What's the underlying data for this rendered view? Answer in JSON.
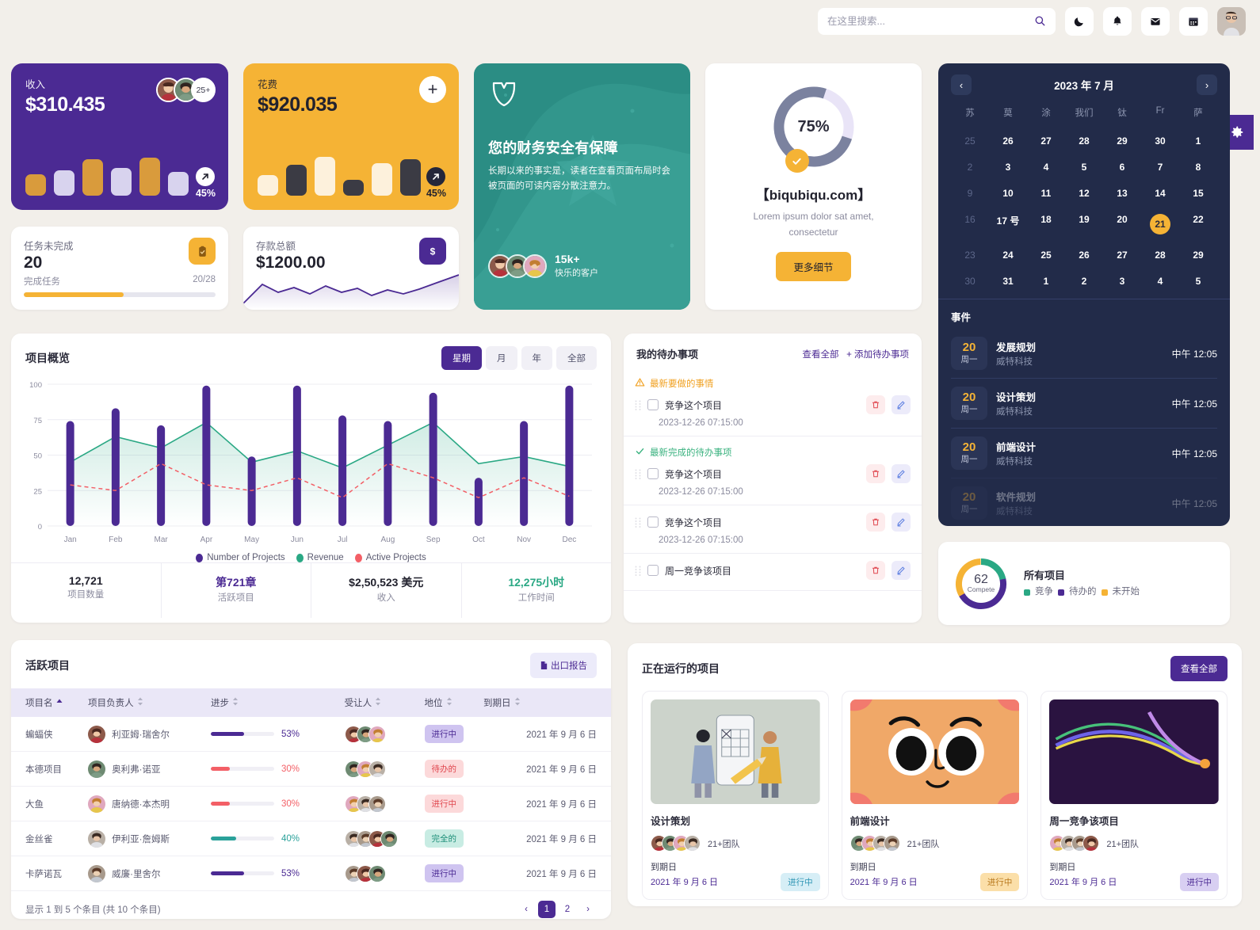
{
  "topbar": {
    "search_placeholder": "在这里搜索...",
    "search_value": "",
    "icons": [
      "moon-icon",
      "bell-icon",
      "mail-icon",
      "calendar-icon"
    ],
    "avatar": "user-avatar"
  },
  "settings_tab": {
    "icon": "gear-icon"
  },
  "kpi": {
    "revenue": {
      "label": "收入",
      "value": "$310.435",
      "extra_count": "25+",
      "percent": "45%",
      "arrow": "arrow-up-right-icon",
      "bars": [
        52,
        62,
        88,
        68,
        92,
        58
      ]
    },
    "expense": {
      "label": "花费",
      "value": "$920.035",
      "percent": "45%",
      "arrow": "arrow-up-right-icon",
      "add_icon": "plus-icon",
      "bars": [
        50,
        75,
        95,
        38,
        78,
        88
      ]
    },
    "tasks": {
      "label": "任务未完成",
      "value": "20",
      "sub_label": "完成任务",
      "ratio": "20/28",
      "progress_percent": 52,
      "icon": "clipboard-check-icon"
    },
    "deposit": {
      "label": "存款总额",
      "value": "$1200.00",
      "icon": "dollar-icon"
    }
  },
  "promo": {
    "title": "您的财务安全有保障",
    "body": "长期以来的事实是，读者在查看页面布局时会被页面的可读内容分散注意力。",
    "logo": "shield-leaf-icon",
    "customers_count": "15k+",
    "customers_label": "快乐的客户"
  },
  "progress_card": {
    "percent": "75%",
    "percent_value": 75,
    "site": "【biqubiqu.com】",
    "lorem": "Lorem ipsum dolor sat amet, consectetur",
    "button": "更多细节",
    "check_icon": "check-icon"
  },
  "calendar": {
    "title": "2023 年 7 月",
    "prev_icon": "chevron-left-icon",
    "next_icon": "chevron-right-icon",
    "dow": [
      "苏",
      "莫",
      "涂",
      "我们",
      "钛",
      "Fr",
      "萨"
    ],
    "weeks": [
      [
        {
          "d": "25",
          "mut": true
        },
        {
          "d": "26"
        },
        {
          "d": "27"
        },
        {
          "d": "28"
        },
        {
          "d": "29"
        },
        {
          "d": "30"
        },
        {
          "d": "1"
        }
      ],
      [
        {
          "d": "2",
          "mut": true
        },
        {
          "d": "3"
        },
        {
          "d": "4"
        },
        {
          "d": "5"
        },
        {
          "d": "6"
        },
        {
          "d": "7"
        },
        {
          "d": "8"
        }
      ],
      [
        {
          "d": "9",
          "mut": true
        },
        {
          "d": "10"
        },
        {
          "d": "11"
        },
        {
          "d": "12"
        },
        {
          "d": "13"
        },
        {
          "d": "14"
        },
        {
          "d": "15"
        }
      ],
      [
        {
          "d": "16",
          "mut": true
        },
        {
          "d": "17 号"
        },
        {
          "d": "18"
        },
        {
          "d": "19"
        },
        {
          "d": "20"
        },
        {
          "d": "21",
          "sel": true
        },
        {
          "d": "22"
        }
      ],
      [
        {
          "d": "23",
          "mut": true
        },
        {
          "d": "24"
        },
        {
          "d": "25"
        },
        {
          "d": "26"
        },
        {
          "d": "27"
        },
        {
          "d": "28"
        },
        {
          "d": "29"
        }
      ],
      [
        {
          "d": "30",
          "mut": true
        },
        {
          "d": "31"
        },
        {
          "d": "1"
        },
        {
          "d": "2"
        },
        {
          "d": "3"
        },
        {
          "d": "4"
        },
        {
          "d": "5"
        }
      ]
    ],
    "events_title": "事件",
    "events": [
      {
        "day": "20",
        "weekday": "周一",
        "name": "发展规划",
        "org": "威特科技",
        "time": "中午 12:05"
      },
      {
        "day": "20",
        "weekday": "周一",
        "name": "设计策划",
        "org": "威特科技",
        "time": "中午 12:05"
      },
      {
        "day": "20",
        "weekday": "周一",
        "name": "前端设计",
        "org": "威特科技",
        "time": "中午 12:05"
      },
      {
        "day": "20",
        "weekday": "周一",
        "name": "软件规划",
        "org": "威特科技",
        "time": "中午 12:05"
      }
    ]
  },
  "overview": {
    "title": "项目概览",
    "range_buttons": [
      "星期",
      "月",
      "年",
      "全部"
    ],
    "active_range": "星期",
    "stats": [
      {
        "value": "12,721",
        "label": "项目数量",
        "color": "#22222e"
      },
      {
        "value": "第721章",
        "label": "活跃项目",
        "color": "#4b2a93"
      },
      {
        "value": "$2,50,523 美元",
        "label": "收入",
        "color": "#22222e"
      },
      {
        "value": "12,275小时",
        "label": "工作时间",
        "color": "#2aa884"
      }
    ]
  },
  "chart_data": {
    "type": "bar",
    "title": "项目概览",
    "xlabel": "",
    "ylabel": "",
    "ylim": [
      0,
      100
    ],
    "yticks": [
      0,
      25,
      50,
      75,
      100
    ],
    "grid": true,
    "legend_position": "bottom",
    "categories": [
      "Jan",
      "Feb",
      "Mar",
      "Apr",
      "May",
      "Jun",
      "Jul",
      "Aug",
      "Sep",
      "Oct",
      "Nov",
      "Dec"
    ],
    "series": [
      {
        "name": "Number of Projects",
        "type": "bar",
        "color": "#4b2a93",
        "values": [
          74,
          83,
          71,
          99,
          49,
          99,
          78,
          74,
          94,
          34,
          74,
          99
        ]
      },
      {
        "name": "Revenue",
        "type": "area",
        "color": "#2aa884",
        "values": [
          45,
          63,
          55,
          73,
          45,
          53,
          41,
          57,
          73,
          44,
          49,
          42
        ]
      },
      {
        "name": "Active Projects",
        "type": "line-dashed",
        "color": "#f35f66",
        "values": [
          29,
          25,
          44,
          29,
          25,
          34,
          20,
          44,
          34,
          20,
          34,
          21
        ]
      }
    ]
  },
  "todo": {
    "title": "我的待办事项",
    "view_all": "查看全部",
    "add": "+ 添加待办事项",
    "groups": [
      {
        "label": "最新要做的事情",
        "icon": "warning-icon",
        "kind": "warn",
        "items": [
          {
            "text": "竞争这个项目",
            "date": "2023-12-26 07:15:00",
            "checked": false
          }
        ]
      },
      {
        "label": "最新完成的待办事项",
        "icon": "check-icon",
        "kind": "done",
        "items": [
          {
            "text": "竞争这个项目",
            "date": "2023-12-26 07:15:00",
            "checked": false
          }
        ]
      },
      {
        "label": "",
        "icon": "",
        "kind": "none",
        "items": [
          {
            "text": "竞争这个项目",
            "date": "2023-12-26 07:15:00",
            "checked": false
          }
        ]
      },
      {
        "label": "",
        "icon": "",
        "kind": "none",
        "items": [
          {
            "text": "周一竞争该项目",
            "date": "",
            "checked": false
          }
        ]
      }
    ],
    "row_icons": {
      "delete": "trash-icon",
      "edit": "pencil-icon",
      "drag": "drag-handle-icon"
    }
  },
  "all_projects": {
    "title": "所有项目",
    "center_number": "62",
    "center_label": "Compete",
    "legend": [
      {
        "label": "竞争",
        "color": "#2aa884",
        "value": 22
      },
      {
        "label": "待办的",
        "color": "#4b2a93",
        "value": 45
      },
      {
        "label": "未开始",
        "color": "#f5b335",
        "value": 33
      }
    ]
  },
  "active_projects": {
    "title": "活跃项目",
    "export_button": "出口报告",
    "export_icon": "file-export-icon",
    "columns": [
      "项目名",
      "项目负责人",
      "进步",
      "受让人",
      "地位",
      "到期日"
    ],
    "sort_icons": {
      "asc": "sort-asc-icon",
      "both": "sort-both-icon"
    },
    "rows": [
      {
        "name": "蝙蝠侠",
        "owner": "利亚姆·瑞舍尔",
        "progress": 53,
        "progress_text": "53%",
        "progress_color": "#4b2a93",
        "assignees": 3,
        "status": "进行中",
        "status_bg": "#cfc4f0",
        "status_fg": "#4b2a93",
        "due": "2021 年 9 月 6 日"
      },
      {
        "name": "本德项目",
        "owner": "奥利弗·诺亚",
        "progress": 30,
        "progress_text": "30%",
        "progress_color": "#f35f66",
        "assignees": 3,
        "status": "待办的",
        "status_bg": "#fcd9da",
        "status_fg": "#e0474f",
        "due": "2021 年 9 月 6 日"
      },
      {
        "name": "大鱼",
        "owner": "唐纳德·本杰明",
        "progress": 30,
        "progress_text": "30%",
        "progress_color": "#f35f66",
        "assignees": 3,
        "status": "进行中",
        "status_bg": "#fcd9da",
        "status_fg": "#e0474f",
        "due": "2021 年 9 月 6 日"
      },
      {
        "name": "金丝雀",
        "owner": "伊利亚·詹姆斯",
        "progress": 40,
        "progress_text": "40%",
        "progress_color": "#2aa19a",
        "assignees": 4,
        "status": "完全的",
        "status_bg": "#c8ece3",
        "status_fg": "#1e8f79",
        "due": "2021 年 9 月 6 日"
      },
      {
        "name": "卡萨诺瓦",
        "owner": "威廉·里舍尔",
        "progress": 53,
        "progress_text": "53%",
        "progress_color": "#4b2a93",
        "assignees": 3,
        "status": "进行中",
        "status_bg": "#cfc4f0",
        "status_fg": "#4b2a93",
        "due": "2021 年 9 月 6 日"
      }
    ],
    "footer_text": "显示 1 到 5 个条目 (共 10 个条目)",
    "pages": [
      "1",
      "2"
    ],
    "active_page": "1",
    "prev_icon": "chevron-left-icon",
    "next_icon": "chevron-right-icon"
  },
  "running_projects": {
    "title": "正在运行的项目",
    "view_all": "查看全部",
    "cards": [
      {
        "name": "设计策划",
        "team": "21+团队",
        "due_label": "到期日",
        "due": "2021 年 9 月 6 日",
        "status": "进行中",
        "status_bg": "#d6eef6",
        "status_fg": "#2d94b3",
        "thumb": "illustration-mobile-design"
      },
      {
        "name": "前端设计",
        "team": "21+团队",
        "due_label": "到期日",
        "due": "2021 年 9 月 6 日",
        "status": "进行中",
        "status_bg": "#fbdfa9",
        "status_fg": "#b8781c",
        "thumb": "illustration-cat-face"
      },
      {
        "name": "周一竞争该项目",
        "team": "21+团队",
        "due_label": "到期日",
        "due": "2021 年 9 月 6 日",
        "status": "进行中",
        "status_bg": "#d8cff2",
        "status_fg": "#4b2a93",
        "thumb": "illustration-abstract-lines"
      }
    ]
  },
  "colors": {
    "accent_purple": "#4b2a93",
    "accent_yellow": "#f5b335",
    "accent_green": "#2aa884",
    "accent_red": "#f35f66",
    "dark_navy": "#222b49",
    "page_bg": "#f2efea"
  }
}
